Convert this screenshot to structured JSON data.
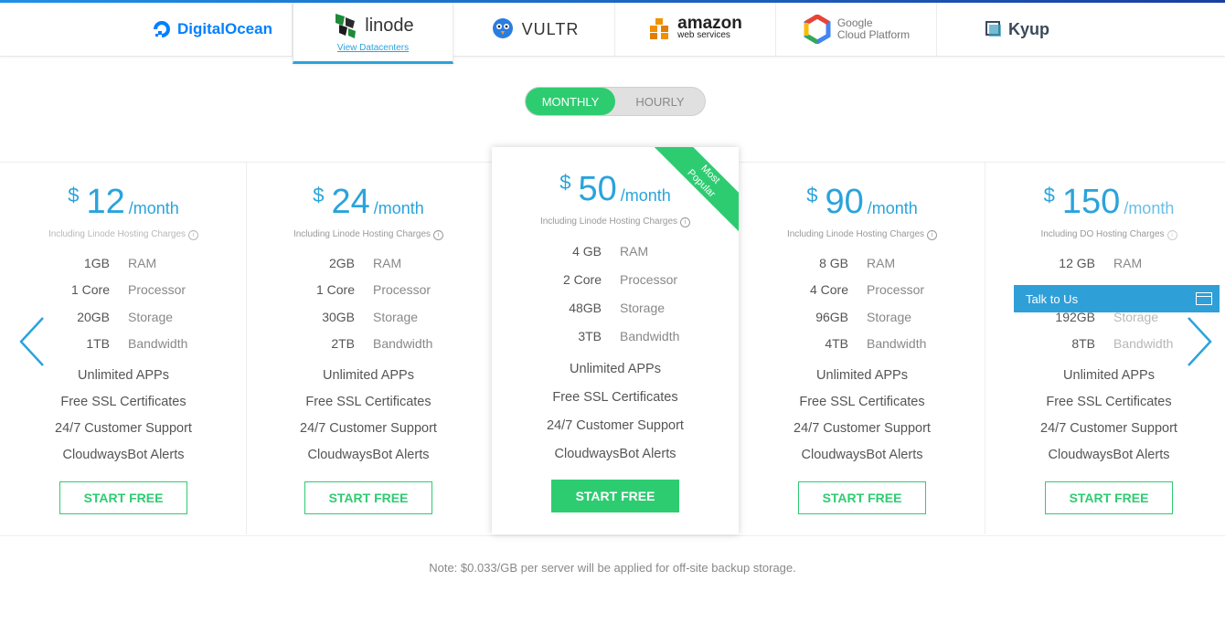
{
  "providers": [
    {
      "name": "DigitalOcean",
      "color": "#0080ff"
    },
    {
      "name": "linode",
      "link": "View Datacenters",
      "color": "#333333"
    },
    {
      "name": "VULTR",
      "color": "#333333"
    },
    {
      "name": "amazon",
      "sub": "web services",
      "color": "#222222"
    },
    {
      "name": "Google",
      "sub": "Cloud Platform",
      "color": "#777777"
    },
    {
      "name": "Kyup",
      "color": "#3a4a5a"
    }
  ],
  "billing_toggle": {
    "monthly": "MONTHLY",
    "hourly": "HOURLY",
    "selected": "MONTHLY"
  },
  "plans": [
    {
      "currency": "$",
      "amount": "12",
      "per": "/month",
      "included": "Including Linode Hosting Charges",
      "specs": [
        {
          "v": "1GB",
          "l": "RAM"
        },
        {
          "v": "1 Core",
          "l": "Processor"
        },
        {
          "v": "20GB",
          "l": "Storage"
        },
        {
          "v": "1TB",
          "l": "Bandwidth"
        }
      ],
      "features": [
        "Unlimited APPs",
        "Free SSL Certificates",
        "24/7 Customer Support",
        "CloudwaysBot Alerts"
      ],
      "cta": "START FREE"
    },
    {
      "currency": "$",
      "amount": "24",
      "per": "/month",
      "included": "Including Linode Hosting Charges",
      "specs": [
        {
          "v": "2GB",
          "l": "RAM"
        },
        {
          "v": "1 Core",
          "l": "Processor"
        },
        {
          "v": "30GB",
          "l": "Storage"
        },
        {
          "v": "2TB",
          "l": "Bandwidth"
        }
      ],
      "features": [
        "Unlimited APPs",
        "Free SSL Certificates",
        "24/7 Customer Support",
        "CloudwaysBot Alerts"
      ],
      "cta": "START FREE"
    },
    {
      "currency": "$",
      "amount": "50",
      "per": "/month",
      "included": "Including Linode Hosting Charges",
      "ribbon": "Most Popular",
      "specs": [
        {
          "v": "4 GB",
          "l": "RAM"
        },
        {
          "v": "2 Core",
          "l": "Processor"
        },
        {
          "v": "48GB",
          "l": "Storage"
        },
        {
          "v": "3TB",
          "l": "Bandwidth"
        }
      ],
      "features": [
        "Unlimited APPs",
        "Free SSL Certificates",
        "24/7 Customer Support",
        "CloudwaysBot Alerts"
      ],
      "cta": "START FREE"
    },
    {
      "currency": "$",
      "amount": "90",
      "per": "/month",
      "included": "Including Linode Hosting Charges",
      "specs": [
        {
          "v": "8 GB",
          "l": "RAM"
        },
        {
          "v": "4 Core",
          "l": "Processor"
        },
        {
          "v": "96GB",
          "l": "Storage"
        },
        {
          "v": "4TB",
          "l": "Bandwidth"
        }
      ],
      "features": [
        "Unlimited APPs",
        "Free SSL Certificates",
        "24/7 Customer Support",
        "CloudwaysBot Alerts"
      ],
      "cta": "START FREE"
    },
    {
      "currency": "$",
      "amount": "150",
      "per": "/month",
      "included": "Including DO Hosting Charges",
      "specs": [
        {
          "v": "12 GB",
          "l": "RAM"
        },
        {
          "v": "",
          "l": ""
        },
        {
          "v": "192GB",
          "l": "Storage"
        },
        {
          "v": "8TB",
          "l": "Bandwidth"
        }
      ],
      "features": [
        "Unlimited APPs",
        "Free SSL Certificates",
        "24/7 Customer Support",
        "CloudwaysBot Alerts"
      ],
      "cta": "START FREE"
    }
  ],
  "note": "Note: $0.033/GB per server will be applied for off-site backup storage.",
  "chat": {
    "label": "Talk to Us"
  },
  "colors": {
    "accent": "#2aa3dc",
    "green": "#2ecc71"
  }
}
